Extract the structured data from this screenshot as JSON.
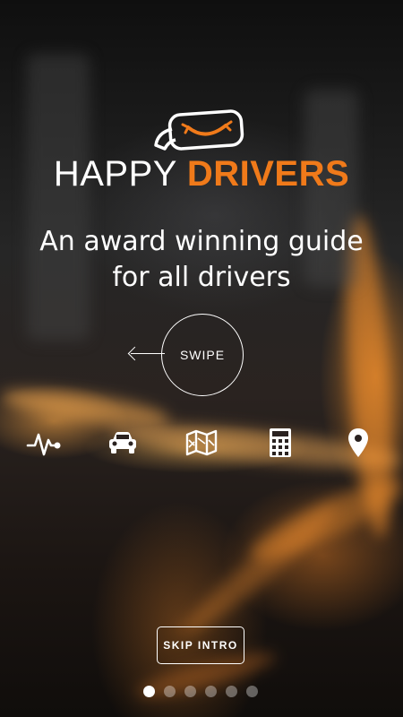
{
  "brand": {
    "word1": "HAPPY",
    "word2": "DRIVERS",
    "accent_color": "#f07a1a",
    "logo_icon": "rearview-mirror-smile-icon"
  },
  "tagline": {
    "line1": "An award winning guide",
    "line2": "for all drivers"
  },
  "swipe": {
    "label": "SWIPE",
    "arrow_icon": "arrow-left-icon"
  },
  "features": [
    {
      "icon": "heartbeat-icon"
    },
    {
      "icon": "car-icon"
    },
    {
      "icon": "map-icon"
    },
    {
      "icon": "calculator-icon"
    },
    {
      "icon": "location-pin-icon"
    }
  ],
  "skip_button": {
    "label": "SKIP INTRO"
  },
  "pagination": {
    "total_pages": 6,
    "current_page": 1
  }
}
